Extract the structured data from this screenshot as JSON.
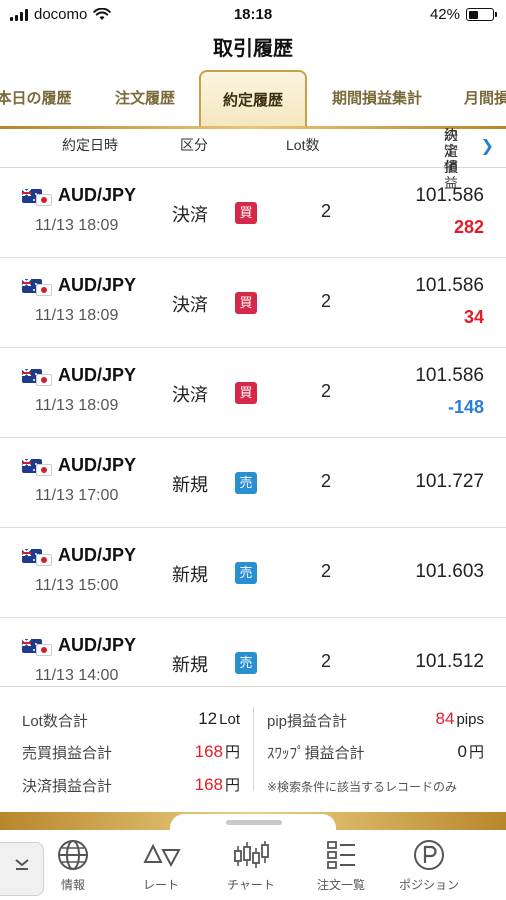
{
  "status": {
    "carrier": "docomo",
    "time": "18:18",
    "battery": "42%"
  },
  "header": {
    "title": "取引履歴"
  },
  "tabs": [
    {
      "label": "本日の履歴"
    },
    {
      "label": "注文履歴"
    },
    {
      "label": "約定履歴",
      "active": true
    },
    {
      "label": "期間損益集計"
    },
    {
      "label": "月間損"
    }
  ],
  "columns": {
    "date": "約定日時",
    "type": "区分",
    "lot": "Lot数",
    "price": "約定値",
    "pl": "決済損益",
    "more_icon": "chevron-right-icon"
  },
  "rows": [
    {
      "pair": "AUD/JPY",
      "datetime": "11/13 18:09",
      "kind": "決済",
      "side": "買",
      "side_type": "buy",
      "lot": "2",
      "price": "101.586",
      "pl": "282",
      "pl_sign": "pos"
    },
    {
      "pair": "AUD/JPY",
      "datetime": "11/13 18:09",
      "kind": "決済",
      "side": "買",
      "side_type": "buy",
      "lot": "2",
      "price": "101.586",
      "pl": "34",
      "pl_sign": "pos"
    },
    {
      "pair": "AUD/JPY",
      "datetime": "11/13 18:09",
      "kind": "決済",
      "side": "買",
      "side_type": "buy",
      "lot": "2",
      "price": "101.586",
      "pl": "-148",
      "pl_sign": "neg"
    },
    {
      "pair": "AUD/JPY",
      "datetime": "11/13 17:00",
      "kind": "新規",
      "side": "売",
      "side_type": "sell",
      "lot": "2",
      "price": "101.727",
      "pl": "",
      "pl_sign": ""
    },
    {
      "pair": "AUD/JPY",
      "datetime": "11/13 15:00",
      "kind": "新規",
      "side": "売",
      "side_type": "sell",
      "lot": "2",
      "price": "101.603",
      "pl": "",
      "pl_sign": ""
    },
    {
      "pair": "AUD/JPY",
      "datetime": "11/13 14:00",
      "kind": "新規",
      "side": "売",
      "side_type": "sell",
      "lot": "2",
      "price": "101.512",
      "pl": "",
      "pl_sign": ""
    }
  ],
  "summary": {
    "lot_total_label": "Lot数合計",
    "lot_total_value": "12",
    "lot_total_unit": "Lot",
    "trade_pl_label": "売買損益合計",
    "trade_pl_value": "168",
    "trade_pl_unit": "円",
    "settle_pl_label": "決済損益合計",
    "settle_pl_value": "168",
    "settle_pl_unit": "円",
    "pip_pl_label": "pip損益合計",
    "pip_pl_value": "84",
    "pip_pl_unit": "pips",
    "swap_pl_label": "ｽﾜｯﾌﾟ損益合計",
    "swap_pl_value": "0",
    "swap_pl_unit": "円",
    "note": "※検索条件に該当するレコードのみ"
  },
  "nav": [
    {
      "label": "情報",
      "icon": "globe-icon"
    },
    {
      "label": "レート",
      "icon": "rate-arrows-icon"
    },
    {
      "label": "チャート",
      "icon": "candlestick-icon"
    },
    {
      "label": "注文一覧",
      "icon": "list-icon"
    },
    {
      "label": "ポジション",
      "icon": "position-p-icon"
    }
  ],
  "colors": {
    "gold": "#c9a043",
    "buy": "#d6294a",
    "sell": "#2a8fd0",
    "positive": "#e11d2a",
    "negative": "#2a7fd4"
  }
}
